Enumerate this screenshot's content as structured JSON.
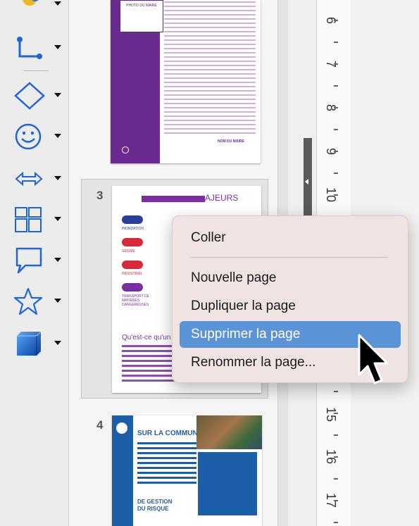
{
  "toolbar": {
    "tools": [
      {
        "icon": "connector-icon"
      },
      {
        "icon": "diamond-icon"
      },
      {
        "icon": "smiley-icon"
      },
      {
        "icon": "double-arrow-icon"
      },
      {
        "icon": "layout-grid-icon"
      },
      {
        "icon": "callout-icon"
      },
      {
        "icon": "star-icon"
      },
      {
        "icon": "cube-icon"
      }
    ]
  },
  "pages": {
    "page3_number": "3",
    "page4_number": "4",
    "page2_signature": "NOM DU MAIRE",
    "page2_cover_text": "PHOTO DU MAIRE",
    "page3_title": "AJEURS",
    "page3_labels": [
      "INONDATION",
      "SÉISME",
      "INDUSTRIEL",
      "TRANSPORT DE MATIÈRES DANGEREUSES"
    ],
    "page3_question": "Qu'est-ce qu'un",
    "page4_title": "SUR LA COMMUNE",
    "page4_subtitle_1": "DE GESTION",
    "page4_subtitle_2": "DU RISQUE"
  },
  "ruler": {
    "labels": [
      "6",
      "7",
      "8",
      "9",
      "10",
      "15",
      "16",
      "17"
    ]
  },
  "context_menu": {
    "paste": "Coller",
    "new_page": "Nouvelle page",
    "duplicate_page": "Dupliquer la page",
    "delete_page": "Supprimer la page",
    "rename_page": "Renommer la page..."
  },
  "colors": {
    "accent": "#5a93d6",
    "page2_purple": "#6b2a8f",
    "page3_red": "#d8283b",
    "page4_blue": "#1c5ea8"
  }
}
